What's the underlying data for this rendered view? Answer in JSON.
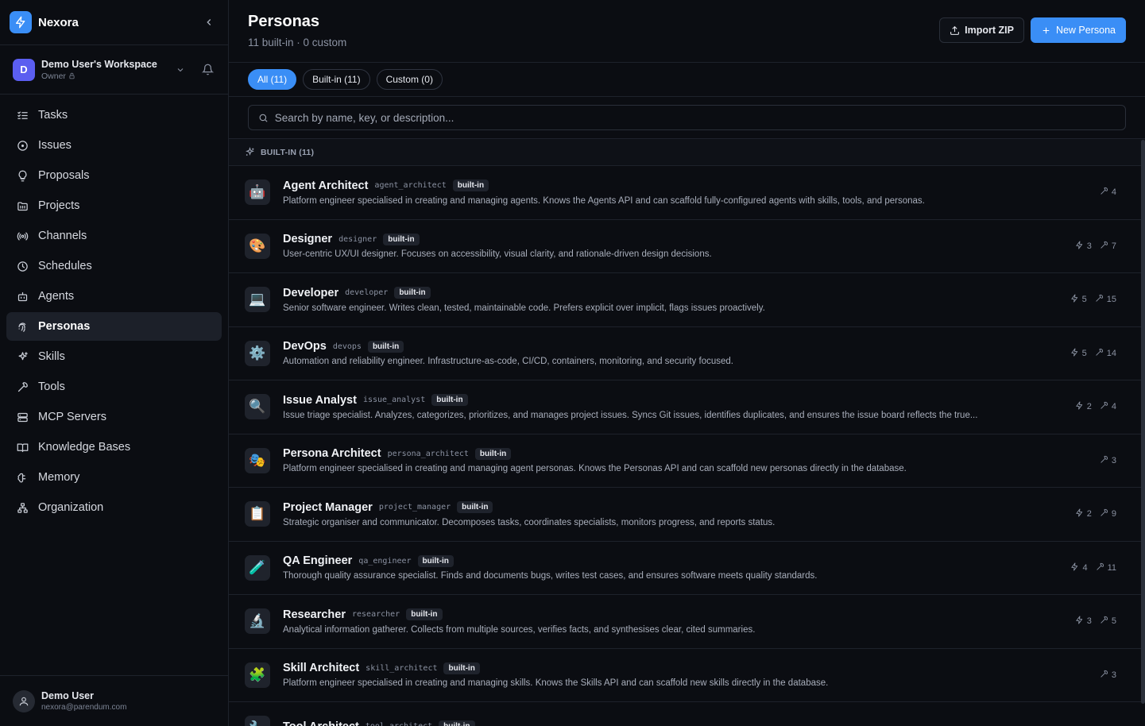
{
  "brand": {
    "name": "Nexora"
  },
  "workspace": {
    "initial": "D",
    "name": "Demo User's Workspace",
    "role": "Owner"
  },
  "nav": [
    {
      "label": "Tasks",
      "icon": "list-checks-icon"
    },
    {
      "label": "Issues",
      "icon": "circle-dot-icon"
    },
    {
      "label": "Proposals",
      "icon": "lightbulb-icon"
    },
    {
      "label": "Projects",
      "icon": "folder-icon"
    },
    {
      "label": "Channels",
      "icon": "radio-icon"
    },
    {
      "label": "Schedules",
      "icon": "clock-icon"
    },
    {
      "label": "Agents",
      "icon": "bot-icon"
    },
    {
      "label": "Personas",
      "icon": "fingerprint-icon",
      "active": true
    },
    {
      "label": "Skills",
      "icon": "sparkles-icon"
    },
    {
      "label": "Tools",
      "icon": "wrench-icon"
    },
    {
      "label": "MCP Servers",
      "icon": "server-icon"
    },
    {
      "label": "Knowledge Bases",
      "icon": "book-open-icon"
    },
    {
      "label": "Memory",
      "icon": "brain-icon"
    },
    {
      "label": "Organization",
      "icon": "org-chart-icon"
    }
  ],
  "user": {
    "name": "Demo User",
    "email": "nexora@parendum.com"
  },
  "header": {
    "title": "Personas",
    "subtitle": "11 built-in · 0 custom",
    "import_label": "Import ZIP",
    "new_label": "New Persona"
  },
  "filters": [
    {
      "label": "All (11)",
      "active": true
    },
    {
      "label": "Built-in (11)"
    },
    {
      "label": "Custom (0)"
    }
  ],
  "search": {
    "placeholder": "Search by name, key, or description..."
  },
  "section": {
    "label": "BUILT-IN (11)"
  },
  "personas": [
    {
      "emoji": "🤖",
      "name": "Agent Architect",
      "key": "agent_architect",
      "badge": "built-in",
      "desc": "Platform engineer specialised in creating and managing agents. Knows the Agents API and can scaffold fully-configured agents with skills, tools, and personas.",
      "skills": null,
      "tools": "4"
    },
    {
      "emoji": "🎨",
      "name": "Designer",
      "key": "designer",
      "badge": "built-in",
      "desc": "User-centric UX/UI designer. Focuses on accessibility, visual clarity, and rationale-driven design decisions.",
      "skills": "3",
      "tools": "7"
    },
    {
      "emoji": "💻",
      "name": "Developer",
      "key": "developer",
      "badge": "built-in",
      "desc": "Senior software engineer. Writes clean, tested, maintainable code. Prefers explicit over implicit, flags issues proactively.",
      "skills": "5",
      "tools": "15"
    },
    {
      "emoji": "⚙️",
      "name": "DevOps",
      "key": "devops",
      "badge": "built-in",
      "desc": "Automation and reliability engineer. Infrastructure-as-code, CI/CD, containers, monitoring, and security focused.",
      "skills": "5",
      "tools": "14"
    },
    {
      "emoji": "🔍",
      "name": "Issue Analyst",
      "key": "issue_analyst",
      "badge": "built-in",
      "desc": "Issue triage specialist. Analyzes, categorizes, prioritizes, and manages project issues. Syncs Git issues, identifies duplicates, and ensures the issue board reflects the true...",
      "skills": "2",
      "tools": "4"
    },
    {
      "emoji": "🎭",
      "name": "Persona Architect",
      "key": "persona_architect",
      "badge": "built-in",
      "desc": "Platform engineer specialised in creating and managing agent personas. Knows the Personas API and can scaffold new personas directly in the database.",
      "skills": null,
      "tools": "3"
    },
    {
      "emoji": "📋",
      "name": "Project Manager",
      "key": "project_manager",
      "badge": "built-in",
      "desc": "Strategic organiser and communicator. Decomposes tasks, coordinates specialists, monitors progress, and reports status.",
      "skills": "2",
      "tools": "9"
    },
    {
      "emoji": "🧪",
      "name": "QA Engineer",
      "key": "qa_engineer",
      "badge": "built-in",
      "desc": "Thorough quality assurance specialist. Finds and documents bugs, writes test cases, and ensures software meets quality standards.",
      "skills": "4",
      "tools": "11"
    },
    {
      "emoji": "🔬",
      "name": "Researcher",
      "key": "researcher",
      "badge": "built-in",
      "desc": "Analytical information gatherer. Collects from multiple sources, verifies facts, and synthesises clear, cited summaries.",
      "skills": "3",
      "tools": "5"
    },
    {
      "emoji": "🧩",
      "name": "Skill Architect",
      "key": "skill_architect",
      "badge": "built-in",
      "desc": "Platform engineer specialised in creating and managing skills. Knows the Skills API and can scaffold new skills directly in the database.",
      "skills": null,
      "tools": "3"
    },
    {
      "emoji": "🔧",
      "name": "Tool Architect",
      "key": "tool_architect",
      "badge": "built-in",
      "desc": "",
      "skills": null,
      "tools": ""
    }
  ]
}
